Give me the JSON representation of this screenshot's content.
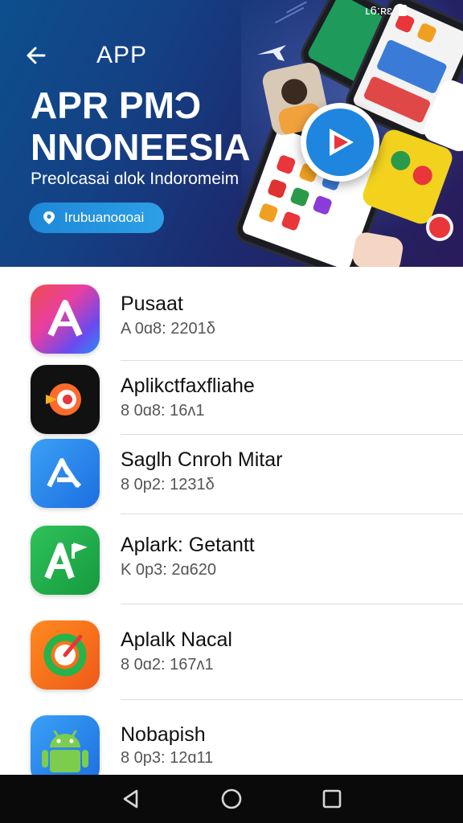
{
  "status_bar": {
    "time_text": "ʟ6:ʀɛ"
  },
  "header": {
    "title": "APP"
  },
  "hero": {
    "title_line1": "APR PMƆ",
    "title_line2": "NNONEESIA",
    "subtitle": "Preolcasai ɑlok Indoromeim",
    "chip_label": "Irubuanoɑoai"
  },
  "apps": [
    {
      "name": "Pusaat",
      "meta": "A 0ɑ8: 2201δ",
      "icon": "gradient-a-icon"
    },
    {
      "name": "Aplikctfaxfliahe",
      "meta": "8 0ɑ8: 16ʌ1",
      "icon": "red-target-icon"
    },
    {
      "name": "Saglh Cnroh Mitar",
      "meta": "8 0p2: 1231δ",
      "icon": "blue-a-icon"
    },
    {
      "name": "Aplark: Getantt",
      "meta": "K 0p3: 2ɑ620",
      "icon": "green-a-flag-icon"
    },
    {
      "name": "Aplalk Nacal",
      "meta": "8 0ɑ2: 167ʌ1",
      "icon": "orange-ring-icon"
    },
    {
      "name": "Nobapish",
      "meta": "8 0p3: 12ɑ11",
      "icon": "android-icon"
    }
  ],
  "colors": {
    "hero_bg": "#153f83",
    "chip": "#2c9fe6",
    "play_blue": "#1f86e0",
    "play_red": "#e8363a",
    "navbar": "#0a0a0a"
  }
}
